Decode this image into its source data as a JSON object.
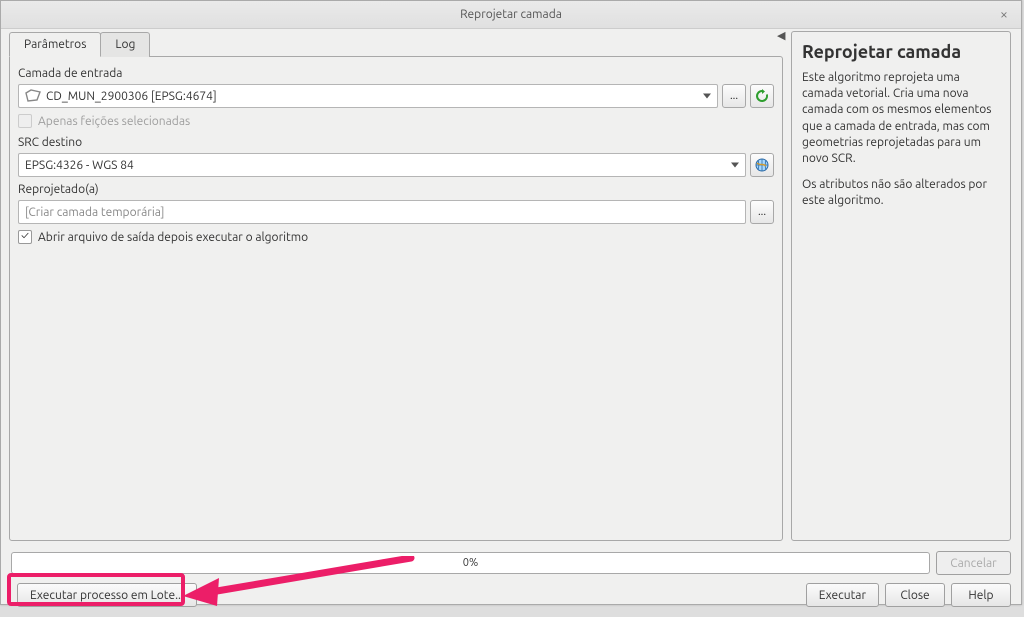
{
  "window": {
    "title": "Reprojetar camada"
  },
  "tabs": {
    "params": "Parâmetros",
    "log": "Log"
  },
  "form": {
    "input_layer_label": "Camada de entrada",
    "input_layer_value": "CD_MUN_2900306 [EPSG:4674]",
    "selected_only": "Apenas feições selecionadas",
    "target_crs_label": "SRC destino",
    "target_crs_value": "EPSG:4326 - WGS 84",
    "reprojected_label": "Reprojetado(a)",
    "reprojected_placeholder": "[Criar camada temporária]",
    "open_output_label": "Abrir arquivo de saída depois executar o algoritmo",
    "more": "..."
  },
  "help": {
    "title": "Reprojetar camada",
    "p1": "Este algoritmo reprojeta uma camada vetorial. Cria uma nova camada com os mesmos elementos que a camada de entrada, mas com geometrias reprojetadas para um novo SCR.",
    "p2": "Os atributos não são alterados por este algoritmo."
  },
  "progress": {
    "text": "0%"
  },
  "buttons": {
    "cancel": "Cancelar",
    "batch": "Executar processo em Lote...",
    "run": "Executar",
    "close": "Close",
    "help": "Help"
  }
}
